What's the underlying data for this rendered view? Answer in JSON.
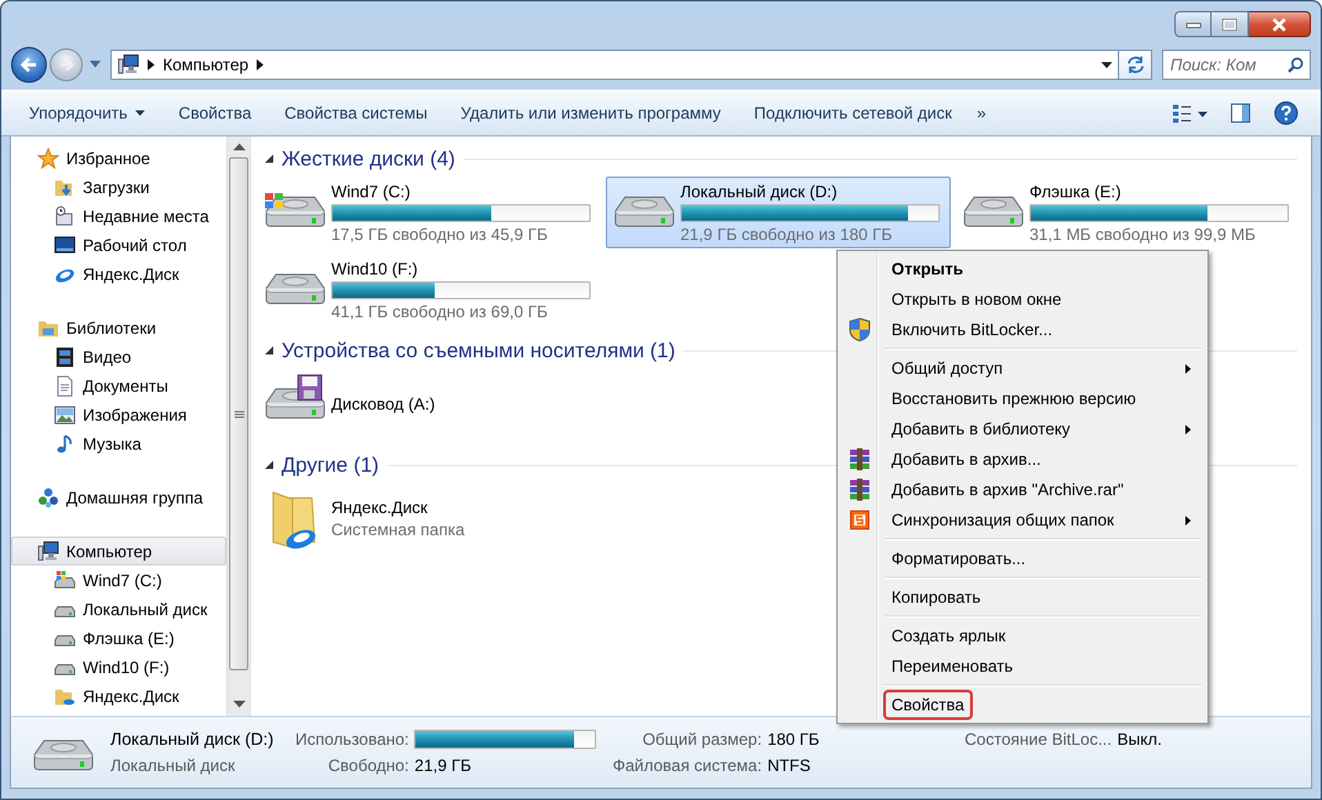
{
  "address": {
    "path": [
      "Компьютер"
    ]
  },
  "search": {
    "placeholder": "Поиск: Ком"
  },
  "toolbar": {
    "items": [
      {
        "label": "Упорядочить",
        "dropdown": true
      },
      {
        "label": "Свойства"
      },
      {
        "label": "Свойства системы"
      },
      {
        "label": "Удалить или изменить программу"
      },
      {
        "label": "Подключить сетевой диск"
      }
    ],
    "more": "»"
  },
  "sidebar": {
    "groups": [
      {
        "label": "Избранное",
        "kind": "star",
        "selected": false,
        "children": [
          {
            "label": "Загрузки",
            "kind": "downloads",
            "selected": false
          },
          {
            "label": "Недавние места",
            "kind": "recent",
            "selected": false
          },
          {
            "label": "Рабочий стол",
            "kind": "desktop",
            "selected": false
          },
          {
            "label": "Яндекс.Диск",
            "kind": "cloud",
            "selected": false
          }
        ]
      },
      {
        "label": "Библиотеки",
        "kind": "library",
        "selected": false,
        "children": [
          {
            "label": "Видео",
            "kind": "video",
            "selected": false
          },
          {
            "label": "Документы",
            "kind": "document",
            "selected": false
          },
          {
            "label": "Изображения",
            "kind": "image",
            "selected": false
          },
          {
            "label": "Музыка",
            "kind": "music",
            "selected": false
          }
        ]
      },
      {
        "label": "Домашняя группа",
        "kind": "homegroup",
        "selected": false
      },
      {
        "label": "Компьютер",
        "kind": "computer",
        "selected": true,
        "children": [
          {
            "label": "Wind7 (C:)",
            "kind": "system-drive",
            "selected": false
          },
          {
            "label": "Локальный диск",
            "kind": "drive",
            "selected": false
          },
          {
            "label": "Флэшка (E:)",
            "kind": "drive",
            "selected": false
          },
          {
            "label": "Wind10 (F:)",
            "kind": "drive",
            "selected": false
          },
          {
            "label": "Яндекс.Диск",
            "kind": "folder",
            "selected": false
          }
        ]
      }
    ]
  },
  "content": {
    "groups": [
      {
        "title": "Жесткие диски (4)",
        "items": [
          {
            "kind": "system-drive",
            "name": "Wind7 (C:)",
            "level": 0.62,
            "free": "17,5 ГБ свободно из 45,9 ГБ",
            "selected": false
          },
          {
            "kind": "drive",
            "name": "Локальный диск (D:)",
            "level": 0.88,
            "free": "21,9 ГБ свободно из 180 ГБ",
            "selected": true
          },
          {
            "kind": "drive",
            "name": "Флэшка (E:)",
            "level": 0.69,
            "free": "31,1 МБ свободно из 99,9 МБ",
            "selected": false
          },
          {
            "kind": "drive",
            "name": "Wind10 (F:)",
            "level": 0.4,
            "free": "41,1 ГБ свободно из 69,0 ГБ",
            "selected": false
          }
        ]
      },
      {
        "title": "Устройства со съемными носителями (1)",
        "items": [
          {
            "kind": "floppy",
            "name": "Дисковод (A:)",
            "selected": false
          }
        ]
      },
      {
        "title": "Другие (1)",
        "items": [
          {
            "kind": "folder",
            "name": "Яндекс.Диск",
            "subtitle": "Системная папка",
            "selected": false
          }
        ]
      }
    ]
  },
  "context_menu": {
    "items": [
      {
        "kind": "item",
        "label": "Открыть",
        "bold": true,
        "selected": false
      },
      {
        "kind": "item",
        "label": "Открыть в новом окне",
        "selected": false
      },
      {
        "kind": "shield",
        "label": "Включить BitLocker...",
        "selected": false
      },
      {
        "kind": "separator"
      },
      {
        "kind": "item",
        "label": "Общий доступ",
        "submenu": true,
        "selected": false
      },
      {
        "kind": "item",
        "label": "Восстановить прежнюю версию",
        "selected": false
      },
      {
        "kind": "item",
        "label": "Добавить в библиотеку",
        "submenu": true,
        "selected": false
      },
      {
        "kind": "archive",
        "label": "Добавить в архив...",
        "selected": false
      },
      {
        "kind": "archive",
        "label": "Добавить в архив \"Archive.rar\"",
        "selected": false
      },
      {
        "kind": "sync",
        "label": "Синхронизация общих папок",
        "submenu": true,
        "selected": false
      },
      {
        "kind": "separator"
      },
      {
        "kind": "item",
        "label": "Форматировать...",
        "selected": false
      },
      {
        "kind": "separator"
      },
      {
        "kind": "item",
        "label": "Копировать",
        "selected": false
      },
      {
        "kind": "separator"
      },
      {
        "kind": "item",
        "label": "Создать ярлык",
        "selected": false
      },
      {
        "kind": "item",
        "label": "Переименовать",
        "selected": false
      },
      {
        "kind": "separator"
      },
      {
        "kind": "item",
        "label": "Свойства",
        "selected": true
      }
    ]
  },
  "details": {
    "title": "Локальный диск (D:)",
    "subtitle": "Локальный диск",
    "fields": [
      {
        "label": "Использовано:",
        "level": 0.88
      },
      {
        "label": "Свободно:",
        "value": "21,9 ГБ"
      },
      {
        "label": "Общий размер:",
        "value": "180 ГБ"
      },
      {
        "label": "Файловая система:",
        "value": "NTFS"
      },
      {
        "label": "Состояние BitLoc...",
        "value": "Выкл."
      }
    ]
  }
}
